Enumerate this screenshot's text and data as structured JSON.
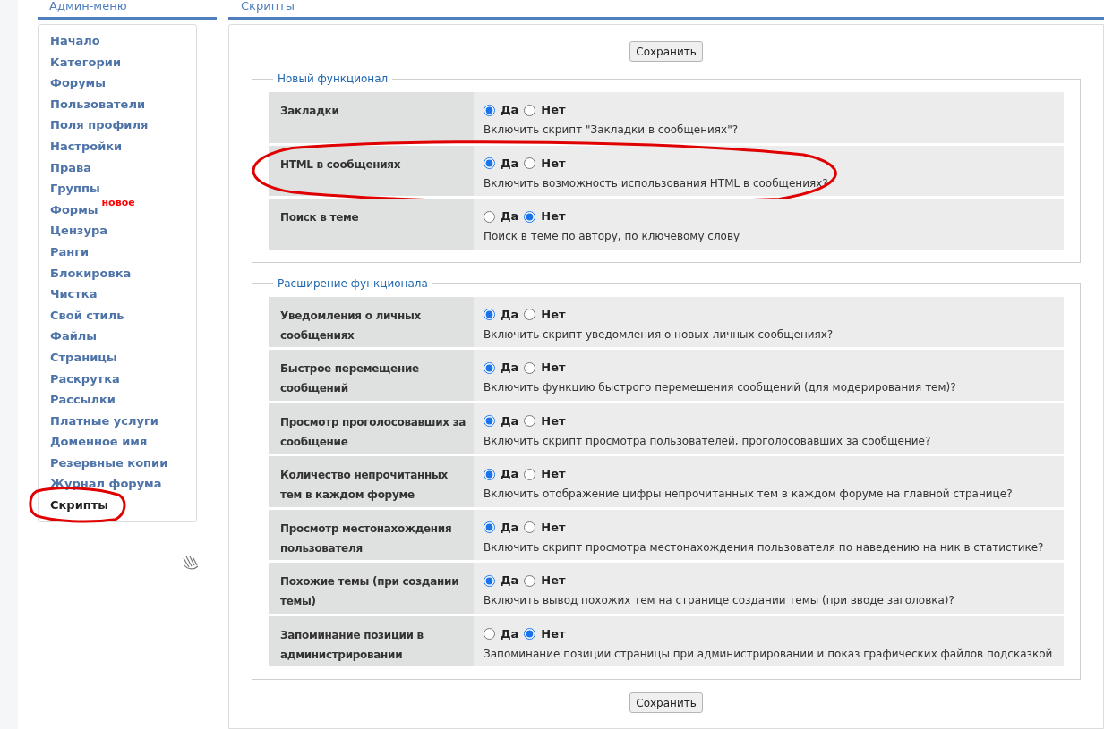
{
  "sidebar": {
    "title": "Админ-меню",
    "items": [
      {
        "label": "Начало",
        "selected": false,
        "circled": false
      },
      {
        "label": "Категории",
        "selected": false,
        "circled": false
      },
      {
        "label": "Форумы",
        "selected": false,
        "circled": false
      },
      {
        "label": "Пользователи",
        "selected": false,
        "circled": false
      },
      {
        "label": "Поля профиля",
        "selected": false,
        "circled": false
      },
      {
        "label": "Настройки",
        "selected": false,
        "circled": false
      },
      {
        "label": "Права",
        "selected": false,
        "circled": false
      },
      {
        "label": "Группы",
        "selected": false,
        "circled": false
      },
      {
        "label": "Формы",
        "badge": "новое",
        "selected": false,
        "circled": false
      },
      {
        "label": "Цензура",
        "selected": false,
        "circled": false
      },
      {
        "label": "Ранги",
        "selected": false,
        "circled": false
      },
      {
        "label": "Блокировка",
        "selected": false,
        "circled": false
      },
      {
        "label": "Чистка",
        "selected": false,
        "circled": false
      },
      {
        "label": "Свой стиль",
        "selected": false,
        "circled": false
      },
      {
        "label": "Файлы",
        "selected": false,
        "circled": false
      },
      {
        "label": "Страницы",
        "selected": false,
        "circled": false
      },
      {
        "label": "Раскрутка",
        "selected": false,
        "circled": false
      },
      {
        "label": "Рассылки",
        "selected": false,
        "circled": false
      },
      {
        "label": "Платные услуги",
        "selected": false,
        "circled": false
      },
      {
        "label": "Доменное имя",
        "selected": false,
        "circled": false
      },
      {
        "label": "Резервные копии",
        "selected": false,
        "circled": false
      },
      {
        "label": "Журнал форума",
        "selected": false,
        "circled": false
      },
      {
        "label": "Скрипты",
        "selected": true,
        "circled": true
      }
    ]
  },
  "main": {
    "title": "Скрипты",
    "save_button_top": "Сохранить",
    "save_button_bottom": "Сохранить",
    "sections": [
      {
        "legend": "Новый функционал",
        "rows": [
          {
            "label": "Закладки",
            "circled": false,
            "options": [
              {
                "label": "Да",
                "selected": true
              },
              {
                "label": "Нет",
                "selected": false
              }
            ],
            "description": "Включить скрипт \"Закладки в сообщениях\"?"
          },
          {
            "label": "HTML в сообщениях",
            "circled": true,
            "options": [
              {
                "label": "Да",
                "selected": true
              },
              {
                "label": "Нет",
                "selected": false
              }
            ],
            "description": "Включить возможность использования HTML в сообщениях?"
          },
          {
            "label": "Поиск в теме",
            "circled": false,
            "options": [
              {
                "label": "Да",
                "selected": false
              },
              {
                "label": "Нет",
                "selected": true
              }
            ],
            "description": "Поиск в теме по автору, по ключевому слову"
          }
        ]
      },
      {
        "legend": "Расширение функционала",
        "rows": [
          {
            "label": "Уведомления о личных сообщениях",
            "circled": false,
            "options": [
              {
                "label": "Да",
                "selected": true
              },
              {
                "label": "Нет",
                "selected": false
              }
            ],
            "description": "Включить скрипт уведомления о новых личных сообщениях?"
          },
          {
            "label": "Быстрое перемещение сообщений",
            "circled": false,
            "options": [
              {
                "label": "Да",
                "selected": true
              },
              {
                "label": "Нет",
                "selected": false
              }
            ],
            "description": "Включить функцию быстрого перемещения сообщений (для модерирования тем)?"
          },
          {
            "label": "Просмотр проголосовавших за сообщение",
            "circled": false,
            "options": [
              {
                "label": "Да",
                "selected": true
              },
              {
                "label": "Нет",
                "selected": false
              }
            ],
            "description": "Включить скрипт просмотра пользователей, проголосовавших за сообщение?"
          },
          {
            "label": "Количество непрочитанных тем в каждом форуме",
            "circled": false,
            "options": [
              {
                "label": "Да",
                "selected": true
              },
              {
                "label": "Нет",
                "selected": false
              }
            ],
            "description": "Включить отображение цифры непрочитанных тем в каждом форуме на главной странице?"
          },
          {
            "label": "Просмотр местонахождения пользователя",
            "circled": false,
            "options": [
              {
                "label": "Да",
                "selected": true
              },
              {
                "label": "Нет",
                "selected": false
              }
            ],
            "description": "Включить скрипт просмотра местонахождения пользователя по наведению на ник в статистике?"
          },
          {
            "label": "Похожие темы (при создании темы)",
            "circled": false,
            "options": [
              {
                "label": "Да",
                "selected": true
              },
              {
                "label": "Нет",
                "selected": false
              }
            ],
            "description": "Включить вывод похожих тем на странице создании темы (при вводе заголовка)?"
          },
          {
            "label": "Запоминание позиции в администрировании",
            "circled": false,
            "options": [
              {
                "label": "Да",
                "selected": false
              },
              {
                "label": "Нет",
                "selected": true
              }
            ],
            "description": "Запоминание позиции страницы при администрировании и показ графических файлов подсказкой"
          }
        ]
      }
    ]
  }
}
